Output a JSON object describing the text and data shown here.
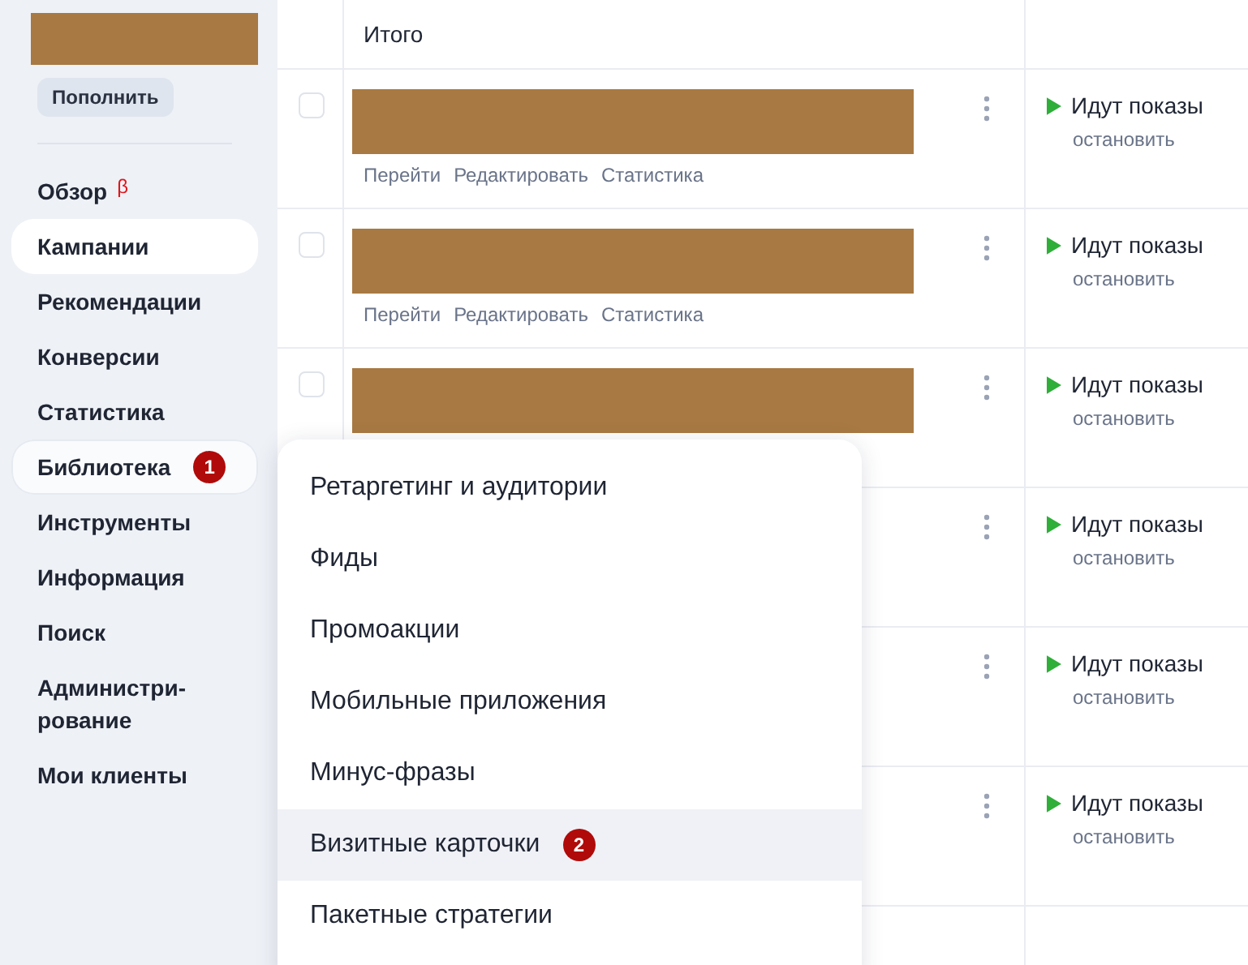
{
  "sidebar": {
    "topup_button": "Пополнить",
    "items": [
      {
        "label": "Обзор",
        "beta": "β",
        "selected": false,
        "expanded": false
      },
      {
        "label": "Кампании",
        "selected": true,
        "expanded": false
      },
      {
        "label": "Рекомендации",
        "selected": false,
        "expanded": false
      },
      {
        "label": "Конверсии",
        "selected": false,
        "expanded": false
      },
      {
        "label": "Статистика",
        "selected": false,
        "expanded": false
      },
      {
        "label": "Библиотека",
        "badge": "1",
        "selected": false,
        "expanded": true
      },
      {
        "label": "Инструменты",
        "selected": false,
        "expanded": false
      },
      {
        "label": "Информация",
        "selected": false,
        "expanded": false
      },
      {
        "label": "Поиск",
        "selected": false,
        "expanded": false
      },
      {
        "label": "Администри-\nрование",
        "selected": false,
        "expanded": false
      },
      {
        "label": "Мои клиенты",
        "selected": false,
        "expanded": false
      }
    ]
  },
  "table": {
    "total_label": "Итого",
    "rows": [
      {
        "checked": false,
        "links": [
          "Перейти",
          "Редактировать",
          "Статистика"
        ],
        "status": "Идут показы",
        "action": "остановить"
      },
      {
        "checked": false,
        "links": [
          "Перейти",
          "Редактировать",
          "Статистика"
        ],
        "status": "Идут показы",
        "action": "остановить"
      },
      {
        "checked": false,
        "links": [],
        "status": "Идут показы",
        "action": "остановить"
      },
      {
        "status": "Идут показы",
        "action": "остановить"
      },
      {
        "status": "Идут показы",
        "action": "остановить"
      },
      {
        "status": "Идут показы",
        "action": "остановить"
      }
    ]
  },
  "library_menu": {
    "items": [
      {
        "label": "Ретаргетинг и аудитории",
        "selected": false
      },
      {
        "label": "Фиды",
        "selected": false
      },
      {
        "label": "Промоакции",
        "selected": false
      },
      {
        "label": "Мобильные приложения",
        "selected": false
      },
      {
        "label": "Минус-фразы",
        "selected": false
      },
      {
        "label": "Визитные карточки",
        "badge": "2",
        "selected": true
      },
      {
        "label": "Пакетные стратегии",
        "selected": false
      }
    ]
  }
}
